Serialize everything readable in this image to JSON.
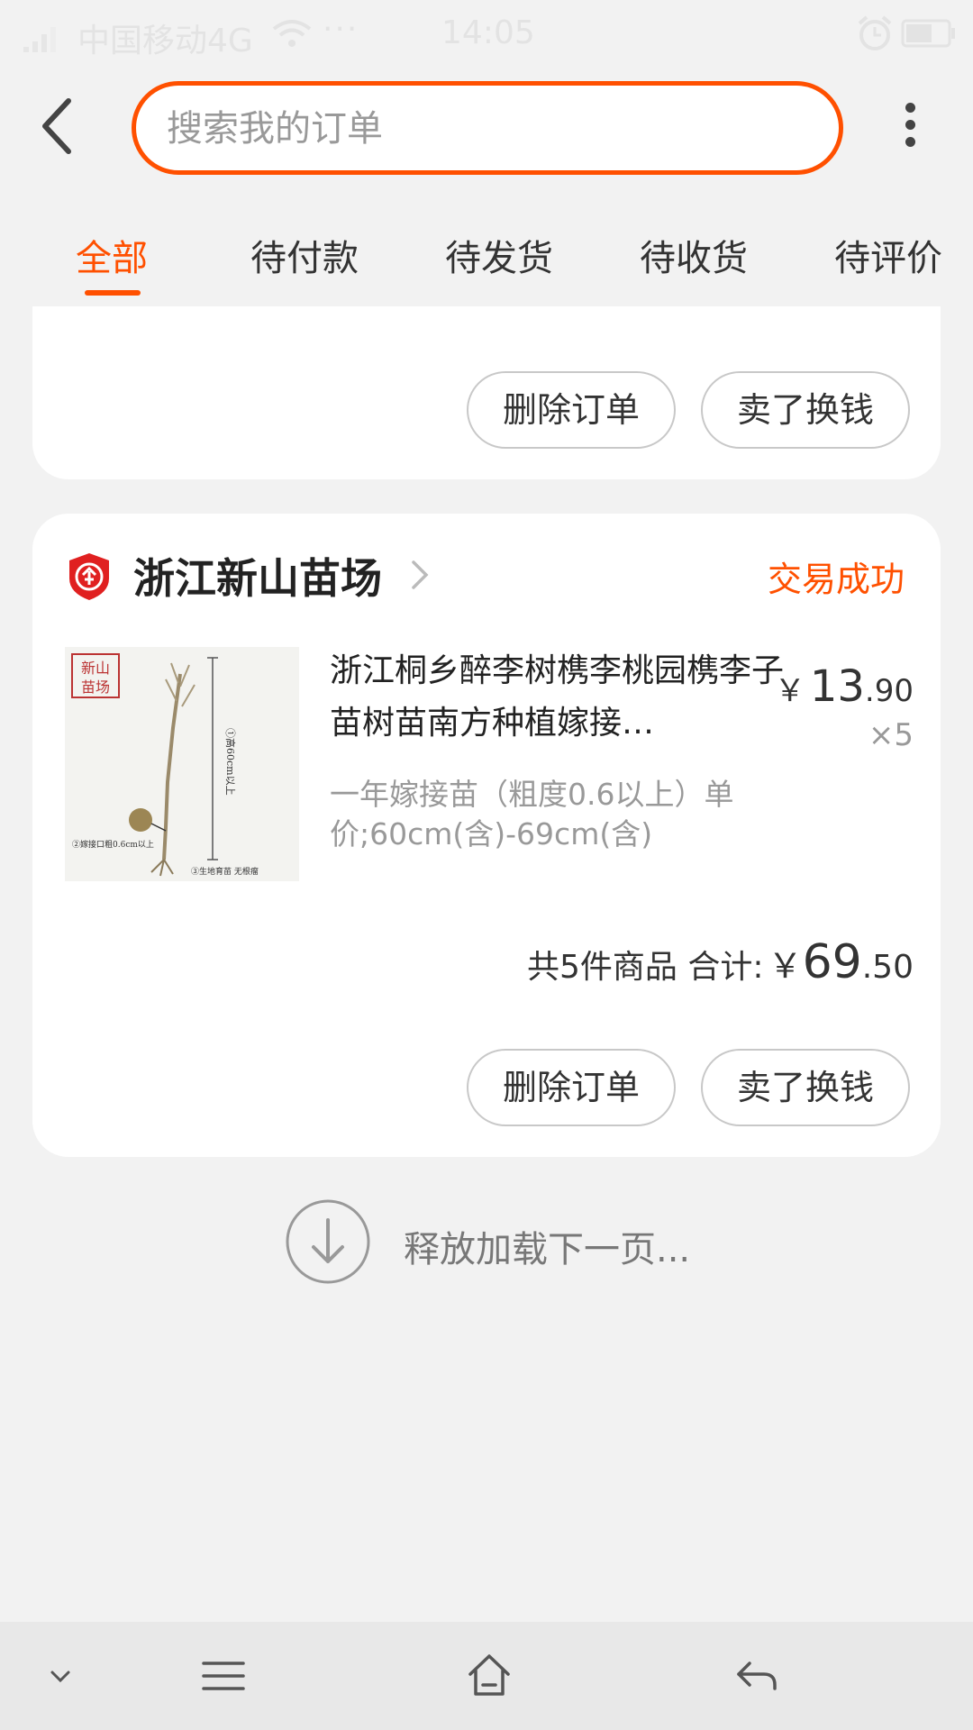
{
  "status_bar": {
    "carrier": "中国移动4G",
    "dots": "···",
    "time": "14:05"
  },
  "header": {
    "search_placeholder": "搜索我的订单"
  },
  "tabs": [
    {
      "label": "全部",
      "active": true
    },
    {
      "label": "待付款",
      "active": false
    },
    {
      "label": "待发货",
      "active": false
    },
    {
      "label": "待收货",
      "active": false
    },
    {
      "label": "待评价",
      "active": false
    }
  ],
  "prev_order": {
    "delete_label": "删除订单",
    "resell_label": "卖了换钱"
  },
  "order": {
    "shop_name": "浙江新山苗场",
    "status": "交易成功",
    "product": {
      "title": "浙江桐乡醉李树槜李桃园槜李子苗树苗南方种植嫁接…",
      "sku": "一年嫁接苗（粗度0.6以上）单价;60cm(含)-69cm(含)",
      "price_currency": "￥",
      "price_int": "13",
      "price_dec": ".90",
      "quantity": "×5",
      "image_text": {
        "stamp": "新山\n苗场",
        "height_note": "①高60cm以上",
        "graft_note": "②嫁接口粗0.6cm以上",
        "root_note": "③生地育苗 无根瘤"
      }
    },
    "summary_text": "共5件商品 合计:",
    "total_currency": "￥",
    "total_int": "69",
    "total_dec": ".50",
    "delete_label": "删除订单",
    "resell_label": "卖了换钱"
  },
  "load_more": {
    "text": "释放加载下一页..."
  },
  "colors": {
    "accent": "#ff5000",
    "background": "#f2f2f2",
    "card": "#ffffff",
    "muted_text": "#999999"
  },
  "icons": {
    "back": "chevron-left-icon",
    "more": "more-vertical-icon",
    "shop": "enterprise-shop-icon",
    "arrow": "chevron-right-icon",
    "load": "arrow-down-circle-icon"
  }
}
